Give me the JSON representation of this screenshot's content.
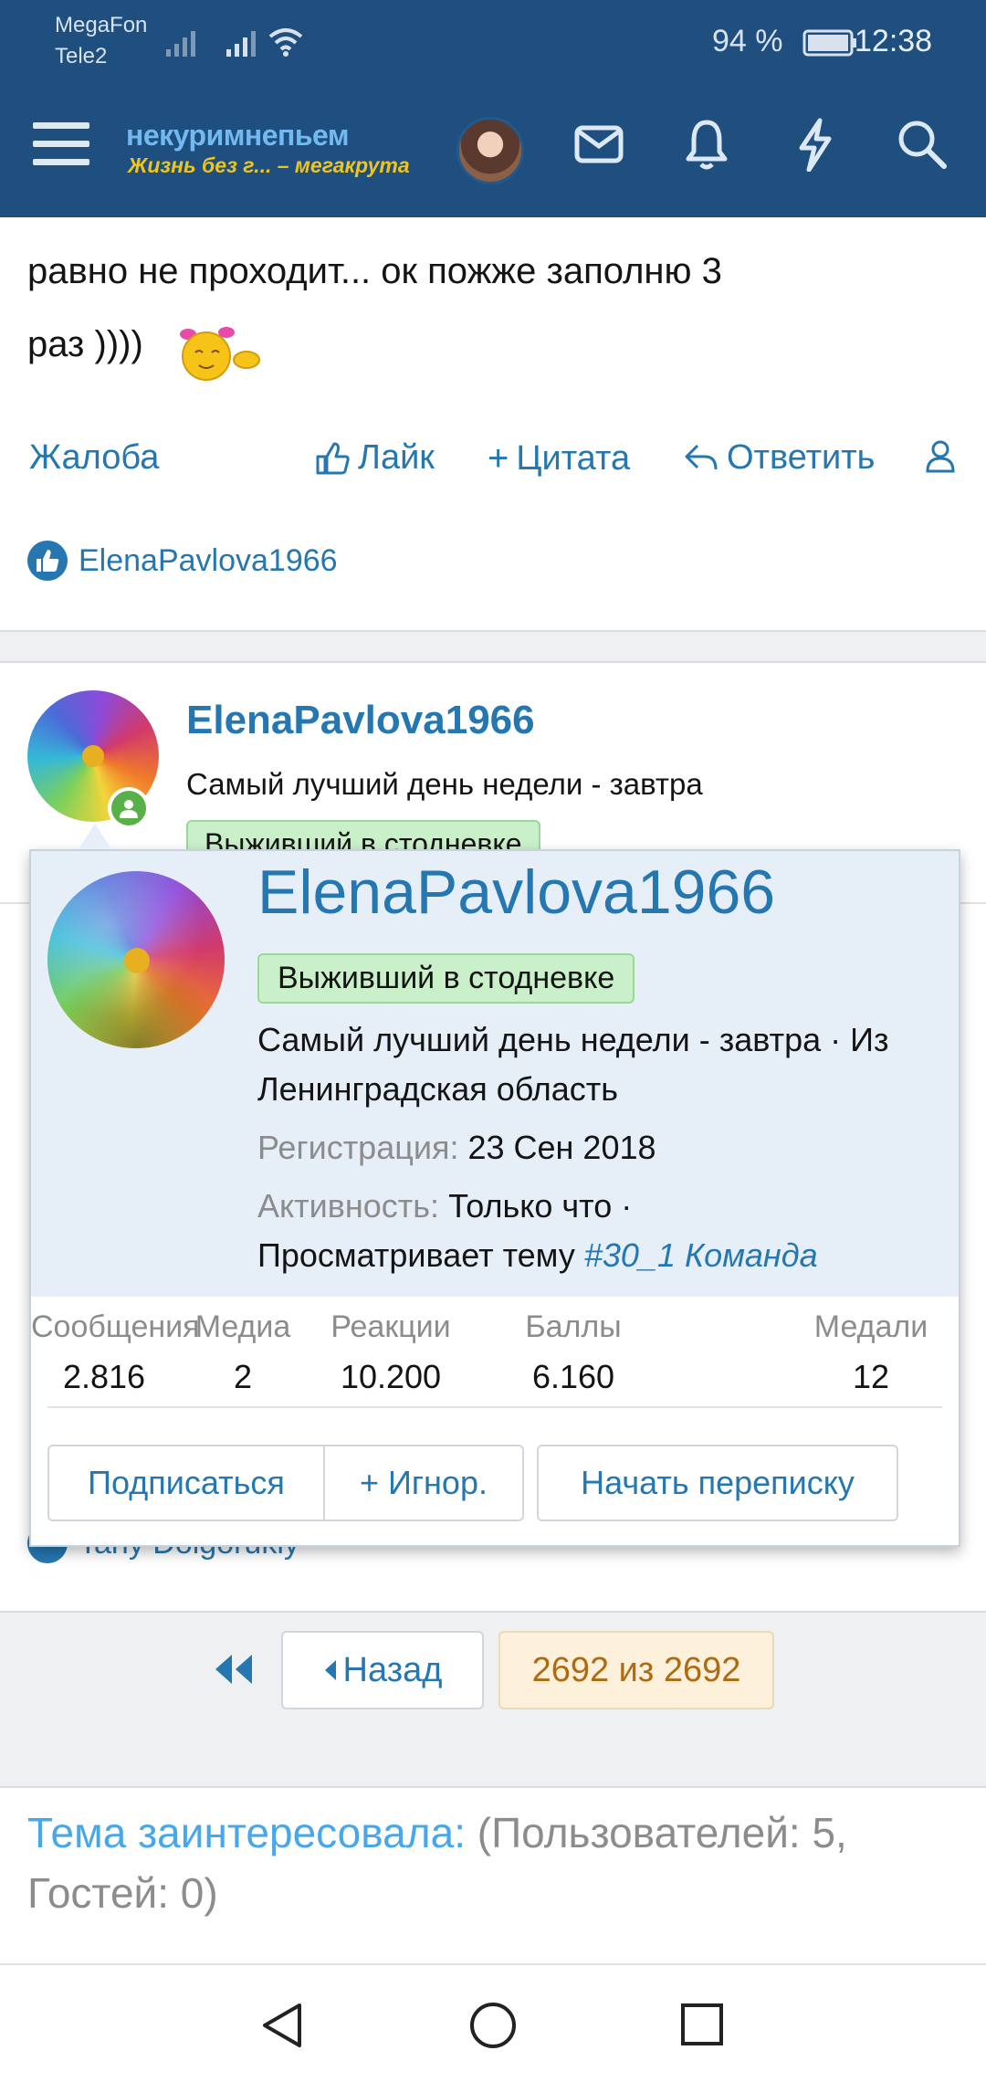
{
  "status_bar": {
    "carrier1": "MegaFon",
    "carrier2": "Tele2",
    "battery": "94 %",
    "time": "12:38"
  },
  "header": {
    "logo_main": "некуримнепьем",
    "logo_sub": "Жизнь без г... – мегакрута",
    "icons": [
      "menu-icon",
      "avatar",
      "mail-icon",
      "bell-icon",
      "lightning-icon",
      "search-icon"
    ]
  },
  "post": {
    "text_line1": "равно не проходит... ок пожже заполню 3",
    "text_line2": "раз ))))",
    "actions": {
      "report": "Жалоба",
      "like": "Лайк",
      "quote": "Цитата",
      "reply": "Ответить"
    },
    "liked_by": "ElenaPavlova1966"
  },
  "post2": {
    "author": "ElenaPavlova1966",
    "user_title": "Самый лучший день недели - завтра",
    "badge": "Выживший в стодневке",
    "liked_by": "Tany Dolgorukiy"
  },
  "member_card": {
    "name": "ElenaPavlova1966",
    "badge": "Выживший в стодневке",
    "title_line1": "Самый лучший день недели - завтра · Из",
    "title_line2": "Ленинградская область",
    "reg_label": "Регистрация:",
    "reg_value": "23 Сен 2018",
    "activity_label": "Активность:",
    "activity_value": "Только что ·",
    "viewing_text": "Просматривает тему",
    "viewing_link": "#30_1 Команда",
    "stats": [
      {
        "label": "Сообщения",
        "value": "2.816"
      },
      {
        "label": "Медиа",
        "value": "2"
      },
      {
        "label": "Реакции",
        "value": "10.200"
      },
      {
        "label": "Баллы",
        "value": "6.160"
      },
      {
        "label": "Медали",
        "value": "12"
      }
    ],
    "buttons": {
      "follow": "Подписаться",
      "ignore": "+ Игнор.",
      "message": "Начать переписку"
    }
  },
  "pagination": {
    "back": "Назад",
    "page": "2692 из 2692"
  },
  "watchers": {
    "label": "Тема заинтересовала:",
    "value": "(Пользователей: 5, Гостей: 0)"
  },
  "colors": {
    "header_bg": "#1e4f7f",
    "link": "#2577b1",
    "badge_bg": "#c9f0c9",
    "card_bg": "#e6eef7"
  }
}
